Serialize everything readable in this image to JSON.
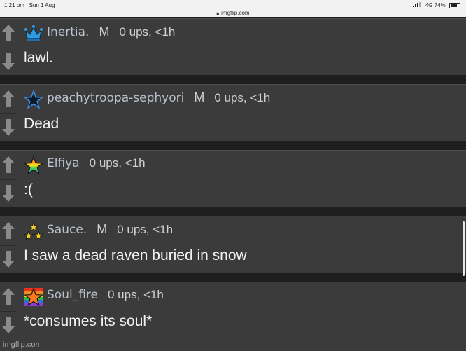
{
  "status_bar": {
    "time": "1:21 pm",
    "date": "Sun 1 Aug",
    "url": "imgflip.com",
    "network": "4G",
    "battery": "74%"
  },
  "comments": [
    {
      "username": "Inertia.",
      "mod_badge": "M",
      "meta": "0 ups, <1h",
      "text": "lawl.",
      "icon": "crown-icon",
      "icon_color": "#2f9be0"
    },
    {
      "username": "peachytroopa-sephyori",
      "mod_badge": "M",
      "meta": "0 ups, <1h",
      "text": "Dead",
      "icon": "star-outline-icon",
      "icon_color": "#3a8fe0"
    },
    {
      "username": "Elfiya",
      "mod_badge": "",
      "meta": "0 ups, <1h",
      "text": ":(",
      "icon": "rainbow-star-icon",
      "icon_color": "#ff4d3b"
    },
    {
      "username": "Sauce.",
      "mod_badge": "M",
      "meta": "0 ups, <1h",
      "text": "I saw a dead raven buried in snow",
      "icon": "three-stars-icon",
      "icon_color": "#f5d02a"
    },
    {
      "username": "Soul_fire",
      "mod_badge": "",
      "meta": "0 ups, <1h",
      "text": "*consumes its soul*",
      "icon": "orange-star-rainbow-icon",
      "icon_color": "#ff7a1a"
    }
  ],
  "watermark": "imgflip.com",
  "colors": {
    "background": "#1e1e1e",
    "comment_bg": "#3b3b3b",
    "username": "#b8c2cc",
    "arrow": "#8a8a8a"
  }
}
